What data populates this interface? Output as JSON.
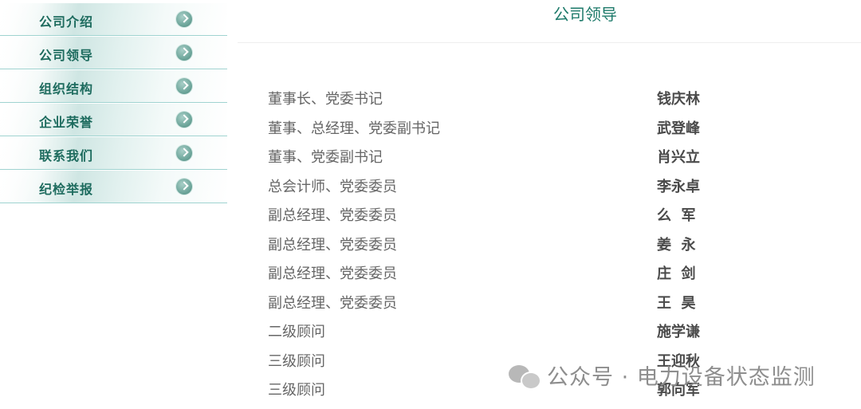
{
  "sidebar": {
    "items": [
      {
        "label": "公司介绍",
        "icon": "arrow-circle-icon"
      },
      {
        "label": "公司领导",
        "icon": "arrow-circle-icon"
      },
      {
        "label": "组织结构",
        "icon": "arrow-circle-icon"
      },
      {
        "label": "企业荣誉",
        "icon": "arrow-circle-icon"
      },
      {
        "label": "联系我们",
        "icon": "arrow-circle-icon"
      },
      {
        "label": "纪检举报",
        "icon": "arrow-circle-icon"
      }
    ]
  },
  "main": {
    "title": "公司领导",
    "leaders": [
      {
        "title": "董事长、党委书记",
        "name": "钱庆林"
      },
      {
        "title": "董事、总经理、党委副书记",
        "name": "武登峰"
      },
      {
        "title": "董事、党委副书记",
        "name": "肖兴立"
      },
      {
        "title": "总会计师、党委委员",
        "name": "李永卓"
      },
      {
        "title": "副总经理、党委委员",
        "name": "么  军"
      },
      {
        "title": "副总经理、党委委员",
        "name": "姜  永"
      },
      {
        "title": "副总经理、党委委员",
        "name": "庄  剑"
      },
      {
        "title": "副总经理、党委委员",
        "name": "王  昊"
      },
      {
        "title": "二级顾问",
        "name": "施学谦"
      },
      {
        "title": "三级顾问",
        "name": "王迎秋"
      },
      {
        "title": "三级顾问",
        "name": "郭向军"
      }
    ]
  },
  "watermark": {
    "text": "公众号 · 电力设备状态监测",
    "icon": "wechat-icon"
  },
  "colors": {
    "accent": "#1d7a6a",
    "sidebar_text": "#1d6b5e",
    "row_text": "#666666",
    "name_text": "#4a4a4a"
  }
}
